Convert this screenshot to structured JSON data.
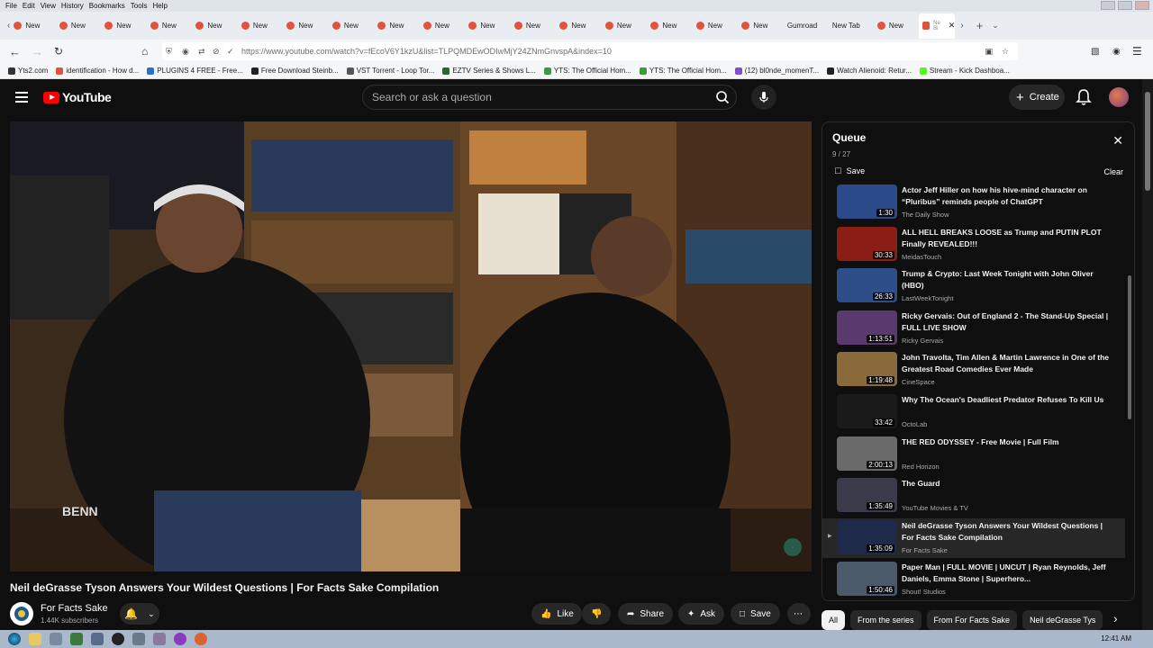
{
  "menubar": {
    "items": [
      "File",
      "Edit",
      "View",
      "History",
      "Bookmarks",
      "Tools",
      "Help"
    ]
  },
  "tabs": {
    "new_label": "New",
    "named": [
      "Gumroad",
      "New Tab"
    ],
    "active_label": "Ne Bi"
  },
  "address": {
    "url": "https://www.youtube.com/watch?v=fEcoV6Y1kzU&list=TLPQMDEwODIwMjY24ZNmGnvspA&index=10"
  },
  "bookmarks": [
    {
      "label": "Yts2.com",
      "color": "#333333"
    },
    {
      "label": "identification - How d...",
      "color": "#e0533c"
    },
    {
      "label": "PLUGINS 4 FREE - Free...",
      "color": "#2b6fd6"
    },
    {
      "label": "Free Download Steinb...",
      "color": "#222222"
    },
    {
      "label": "VST Torrent - Loop Tor...",
      "color": "#555555"
    },
    {
      "label": "EZTV Series & Shows L...",
      "color": "#1e6a3a"
    },
    {
      "label": "YTS: The Official Hom...",
      "color": "#3a9b3a"
    },
    {
      "label": "YTS: The Official Hom...",
      "color": "#3a9b3a"
    },
    {
      "label": "(12) bl0nde_momenT...",
      "color": "#7a52c7"
    },
    {
      "label": "Watch Alienoid: Retur...",
      "color": "#222222"
    },
    {
      "label": "Stream - Kick Dashboa...",
      "color": "#53fc18"
    }
  ],
  "youtube": {
    "logo_text": "YouTube",
    "search_placeholder": "Search or ask a question",
    "create_label": "Create"
  },
  "video": {
    "title": "Neil deGrasse Tyson Answers Your Wildest Questions | For Facts Sake Compilation",
    "channel": "For Facts Sake",
    "subscribers": "1.44K subscribers",
    "actions": {
      "like": "Like",
      "share": "Share",
      "ask": "Ask",
      "save": "Save"
    },
    "watermark": "BENN"
  },
  "queue": {
    "title": "Queue",
    "count": "9 / 27",
    "save": "Save",
    "clear": "Clear",
    "items": [
      {
        "title": "Actor Jeff Hiller on how his hive-mind character on “Pluribus” reminds people of ChatGPT",
        "channel": "The Daily Show",
        "duration": "1:30",
        "thumb": "#2a4a8a"
      },
      {
        "title": "ALL HELL BREAKS LOOSE as Trump and PUTIN PLOT Finally REVEALED!!!",
        "channel": "MeidasTouch",
        "duration": "30:33",
        "thumb": "#8a1e14"
      },
      {
        "title": "Trump & Crypto: Last Week Tonight with John Oliver (HBO)",
        "channel": "LastWeekTonight",
        "duration": "26:33",
        "thumb": "#2e4e8a"
      },
      {
        "title": "Ricky Gervais: Out of England 2 - The Stand-Up Special | FULL LIVE SHOW",
        "channel": "Ricky Gervais",
        "duration": "1:13:51",
        "thumb": "#5a3a6e"
      },
      {
        "title": "John Travolta, Tim Allen & Martin Lawrence in One of the Greatest Road Comedies Ever Made",
        "channel": "CineSpace",
        "duration": "1:19:48",
        "thumb": "#8a6a3a"
      },
      {
        "title": "Why The Ocean's Deadliest Predator Refuses To Kill Us",
        "channel": "OctoLab",
        "duration": "33:42",
        "thumb": "#1a1a1a"
      },
      {
        "title": "THE RED ODYSSEY - Free Movie | Full Film",
        "channel": "Red Horizon",
        "duration": "2:00:13",
        "thumb": "#6a6a6a"
      },
      {
        "title": "The Guard",
        "channel": "YouTube Movies & TV",
        "duration": "1:35:49",
        "thumb": "#3a3a4a"
      },
      {
        "title": "Neil deGrasse Tyson Answers Your Wildest Questions | For Facts Sake Compilation",
        "channel": "For Facts Sake",
        "duration": "1:35:09",
        "thumb": "#1e2a4a",
        "current": true
      },
      {
        "title": "Paper Man | FULL MOVIE | UNCUT | Ryan Reynolds, Jeff Daniels, Emma Stone | Superhero...",
        "channel": "Shout! Studios",
        "duration": "1:50:46",
        "thumb": "#4a5a6a"
      }
    ]
  },
  "chips": [
    "All",
    "From the series",
    "From For Facts Sake",
    "Neil deGrasse Tys"
  ],
  "taskbar": {
    "time": "12:41 AM"
  }
}
